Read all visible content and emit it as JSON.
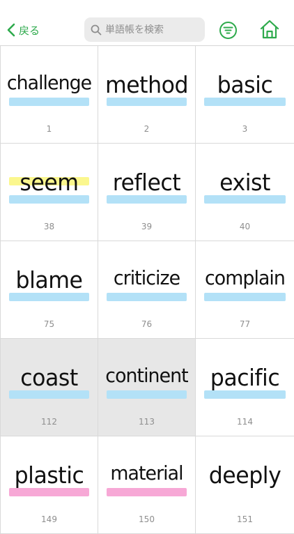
{
  "header": {
    "back_label": "戻る",
    "search_placeholder": "単語帳を検索",
    "accent_color": "#2eaa4c"
  },
  "colors": {
    "blue": "#b3e1f7",
    "yellow": "#fbf78e",
    "pink": "#f7a8d6",
    "selected_bg": "#e7e7e7"
  },
  "words": [
    {
      "word": "challenge",
      "num": "1",
      "highlights": [
        "blue"
      ],
      "selected": false
    },
    {
      "word": "method",
      "num": "2",
      "highlights": [
        "blue"
      ],
      "selected": false
    },
    {
      "word": "basic",
      "num": "3",
      "highlights": [
        "blue"
      ],
      "selected": false
    },
    {
      "word": "seem",
      "num": "38",
      "highlights": [
        "yellow",
        "blue"
      ],
      "selected": false
    },
    {
      "word": "reflect",
      "num": "39",
      "highlights": [
        "blue"
      ],
      "selected": false
    },
    {
      "word": "exist",
      "num": "40",
      "highlights": [
        "blue"
      ],
      "selected": false
    },
    {
      "word": "blame",
      "num": "75",
      "highlights": [
        "blue"
      ],
      "selected": false
    },
    {
      "word": "criticize",
      "num": "76",
      "highlights": [
        "blue"
      ],
      "selected": false
    },
    {
      "word": "complain",
      "num": "77",
      "highlights": [
        "blue"
      ],
      "selected": false
    },
    {
      "word": "coast",
      "num": "112",
      "highlights": [
        "blue"
      ],
      "selected": true
    },
    {
      "word": "continent",
      "num": "113",
      "highlights": [
        "blue"
      ],
      "selected": true
    },
    {
      "word": "pacific",
      "num": "114",
      "highlights": [
        "blue"
      ],
      "selected": false
    },
    {
      "word": "plastic",
      "num": "149",
      "highlights": [
        "pink"
      ],
      "selected": false
    },
    {
      "word": "material",
      "num": "150",
      "highlights": [
        "pink"
      ],
      "selected": false
    },
    {
      "word": "deeply",
      "num": "151",
      "highlights": [],
      "selected": false
    }
  ]
}
